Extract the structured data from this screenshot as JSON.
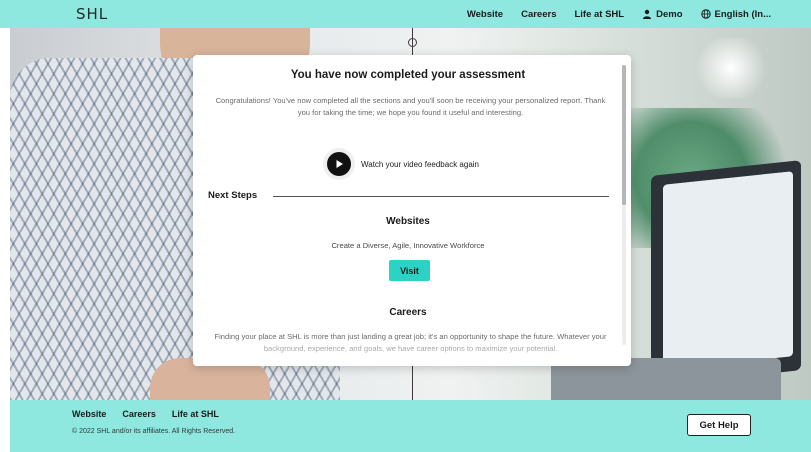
{
  "header": {
    "logo": "SHL",
    "nav": [
      {
        "label": "Website"
      },
      {
        "label": "Careers"
      },
      {
        "label": "Life at SHL"
      },
      {
        "label": "Demo",
        "icon": "person-icon"
      },
      {
        "label": "English (In...",
        "icon": "globe-icon"
      }
    ]
  },
  "modal": {
    "title": "You have now completed your assessment",
    "intro": "Congratulations! You've now completed all the sections and you'll soon be receiving your personalized report. Thank you for taking the time; we hope you found it useful and interesting.",
    "video_label": "Watch your video feedback again",
    "next_steps": "Next Steps",
    "websites": {
      "title": "Websites",
      "desc": "Create a Diverse, Agile, Innovative Workforce",
      "button": "Visit"
    },
    "careers": {
      "title": "Careers",
      "desc": "Finding your place at SHL is more than just landing a great job; it's an opportunity to shape the future. Whatever your background, experience, and goals, we have career options to maximize your potential."
    }
  },
  "footer": {
    "links": [
      "Website",
      "Careers",
      "Life at SHL"
    ],
    "copyright": "© 2022 SHL and/or its affiliates. All Rights Reserved.",
    "help_button": "Get Help"
  },
  "colors": {
    "accent": "#8ee8e0",
    "button": "#2cd3c4"
  }
}
